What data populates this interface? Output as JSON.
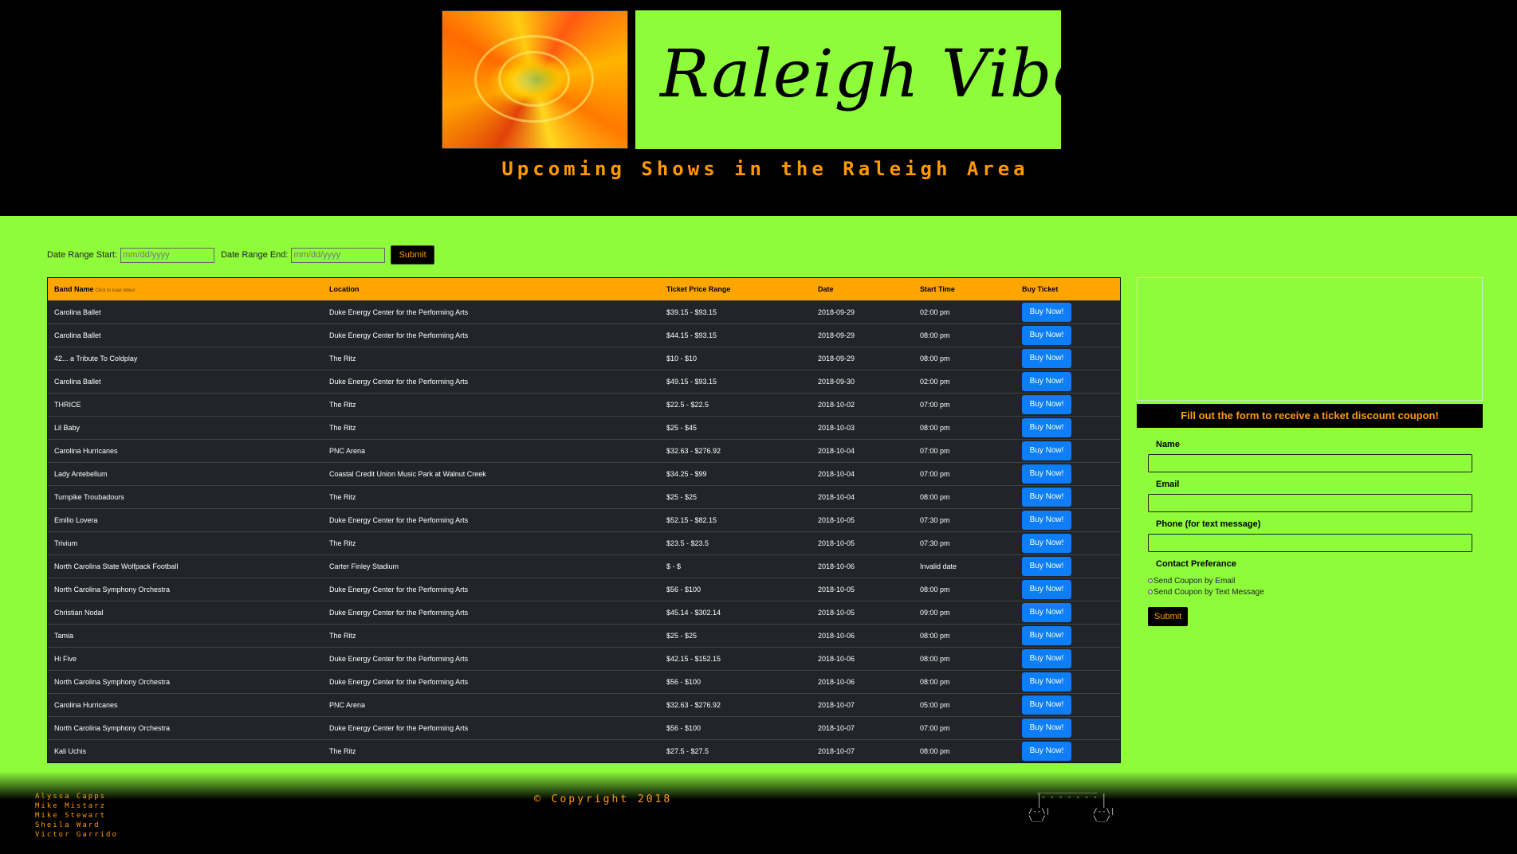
{
  "header": {
    "logo_text": "Raleigh Vibes",
    "subtitle": "Upcoming Shows in the Raleigh Area"
  },
  "filter": {
    "start_label": "Date Range Start:",
    "start_placeholder": "mm/dd/yyyy",
    "end_label": "Date Range End:",
    "end_placeholder": "mm/dd/yyyy",
    "submit_label": "Submit"
  },
  "table": {
    "columns": [
      "Band Name",
      "Location",
      "Ticket Price Range",
      "Date",
      "Start Time",
      "Buy Ticket"
    ],
    "band_hint": "Click to load video!",
    "buy_label": "Buy Now!",
    "rows": [
      {
        "band": "Carolina Ballet",
        "location": "Duke Energy Center for the Performing Arts",
        "price": "$39.15 - $93.15",
        "date": "2018-09-29",
        "time": "02:00 pm"
      },
      {
        "band": "Carolina Ballet",
        "location": "Duke Energy Center for the Performing Arts",
        "price": "$44.15 - $93.15",
        "date": "2018-09-29",
        "time": "08:00 pm"
      },
      {
        "band": "42... a Tribute To Coldplay",
        "location": "The Ritz",
        "price": "$10 - $10",
        "date": "2018-09-29",
        "time": "08:00 pm"
      },
      {
        "band": "Carolina Ballet",
        "location": "Duke Energy Center for the Performing Arts",
        "price": "$49.15 - $93.15",
        "date": "2018-09-30",
        "time": "02:00 pm"
      },
      {
        "band": "THRICE",
        "location": "The Ritz",
        "price": "$22.5 - $22.5",
        "date": "2018-10-02",
        "time": "07:00 pm"
      },
      {
        "band": "Lil Baby",
        "location": "The Ritz",
        "price": "$25 - $45",
        "date": "2018-10-03",
        "time": "08:00 pm"
      },
      {
        "band": "Carolina Hurricanes",
        "location": "PNC Arena",
        "price": "$32.63 - $276.92",
        "date": "2018-10-04",
        "time": "07:00 pm"
      },
      {
        "band": "Lady Antebellum",
        "location": "Coastal Credit Union Music Park at Walnut Creek",
        "price": "$34.25 - $99",
        "date": "2018-10-04",
        "time": "07:00 pm"
      },
      {
        "band": "Turnpike Troubadours",
        "location": "The Ritz",
        "price": "$25 - $25",
        "date": "2018-10-04",
        "time": "08:00 pm"
      },
      {
        "band": "Emilio Lovera",
        "location": "Duke Energy Center for the Performing Arts",
        "price": "$52.15 - $82.15",
        "date": "2018-10-05",
        "time": "07:30 pm"
      },
      {
        "band": "Trivium",
        "location": "The Ritz",
        "price": "$23.5 - $23.5",
        "date": "2018-10-05",
        "time": "07:30 pm"
      },
      {
        "band": "North Carolina State Wolfpack Football",
        "location": "Carter Finley Stadium",
        "price": "$ - $",
        "date": "2018-10-06",
        "time": "Invalid date"
      },
      {
        "band": "North Carolina Symphony Orchestra",
        "location": "Duke Energy Center for the Performing Arts",
        "price": "$56 - $100",
        "date": "2018-10-05",
        "time": "08:00 pm"
      },
      {
        "band": "Christian Nodal",
        "location": "Duke Energy Center for the Performing Arts",
        "price": "$45.14 - $302.14",
        "date": "2018-10-05",
        "time": "09:00 pm"
      },
      {
        "band": "Tamia",
        "location": "The Ritz",
        "price": "$25 - $25",
        "date": "2018-10-06",
        "time": "08:00 pm"
      },
      {
        "band": "Hi Five",
        "location": "Duke Energy Center for the Performing Arts",
        "price": "$42.15 - $152.15",
        "date": "2018-10-06",
        "time": "08:00 pm"
      },
      {
        "band": "North Carolina Symphony Orchestra",
        "location": "Duke Energy Center for the Performing Arts",
        "price": "$56 - $100",
        "date": "2018-10-06",
        "time": "08:00 pm"
      },
      {
        "band": "Carolina Hurricanes",
        "location": "PNC Arena",
        "price": "$32.63 - $276.92",
        "date": "2018-10-07",
        "time": "05:00 pm"
      },
      {
        "band": "North Carolina Symphony Orchestra",
        "location": "Duke Energy Center for the Performing Arts",
        "price": "$56 - $100",
        "date": "2018-10-07",
        "time": "07:00 pm"
      },
      {
        "band": "Kali Uchis",
        "location": "The Ritz",
        "price": "$27.5 - $27.5",
        "date": "2018-10-07",
        "time": "08:00 pm"
      }
    ]
  },
  "coupon": {
    "banner": "Fill out the form to receive a ticket discount coupon!",
    "name_label": "Name",
    "email_label": "Email",
    "phone_label": "Phone (for text message)",
    "contact_label": "Contact Preferance",
    "option_email": "Send Coupon by Email",
    "option_text": "Send Coupon by Text Message",
    "submit_label": "Submit"
  },
  "footer": {
    "authors": [
      "Alyssa Capps",
      "Mike Mistarz",
      "Mike Stewart",
      "Sheila Ward",
      "Victor Garrido"
    ],
    "copyright": "© Copyright 2018"
  },
  "colors": {
    "accent_green": "#8efc3a",
    "accent_orange": "#ff9900",
    "table_header": "#ffa500",
    "button_blue": "#0d7ef6",
    "table_bg": "#212529"
  }
}
